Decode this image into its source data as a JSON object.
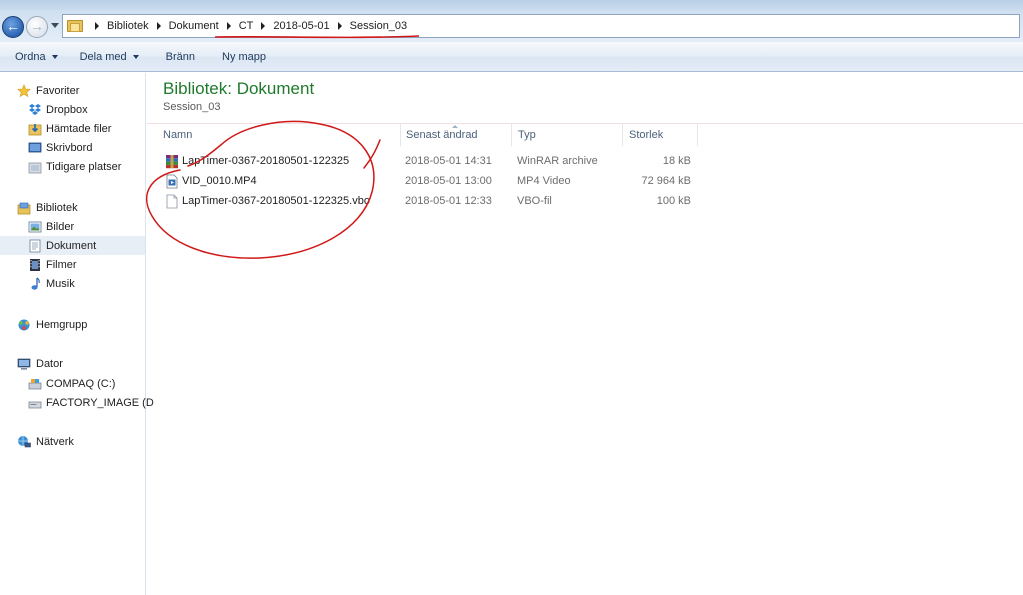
{
  "address": {
    "crumbs": [
      "Bibliotek",
      "Dokument",
      "CT",
      "2018-05-01",
      "Session_03"
    ]
  },
  "toolbar": {
    "organize_label": "Ordna",
    "share_label": "Dela med",
    "burn_label": "Bränn",
    "new_folder_label": "Ny mapp"
  },
  "sidebar": {
    "favorites_label": "Favoriter",
    "favorites": [
      "Dropbox",
      "Hämtade filer",
      "Skrivbord",
      "Tidigare platser"
    ],
    "libraries_label": "Bibliotek",
    "libraries": [
      "Bilder",
      "Dokument",
      "Filmer",
      "Musik"
    ],
    "selected": "Dokument",
    "homegroup_label": "Hemgrupp",
    "computer_label": "Dator",
    "drives": [
      "COMPAQ (C:)",
      "FACTORY_IMAGE (D"
    ],
    "network_label": "Nätverk"
  },
  "content": {
    "title": "Bibliotek: Dokument",
    "subtitle": "Session_03",
    "columns": {
      "name": "Namn",
      "modified": "Senast ändrad",
      "type": "Typ",
      "size": "Storlek"
    },
    "files": [
      {
        "name": "LapTimer-0367-20180501-122325",
        "modified": "2018-05-01 14:31",
        "type": "WinRAR archive",
        "size": "18 kB",
        "icon": "winrar-archive-icon"
      },
      {
        "name": "VID_0010.MP4",
        "modified": "2018-05-01 13:00",
        "type": "MP4 Video",
        "size": "72 964 kB",
        "icon": "video-file-icon"
      },
      {
        "name": "LapTimer-0367-20180501-122325.vbo",
        "modified": "2018-05-01 12:33",
        "type": "VBO-fil",
        "size": "100 kB",
        "icon": "blank-file-icon"
      }
    ]
  },
  "annotations": {
    "marker_color": "#d01818"
  },
  "colors": {
    "title_green": "#1f7a2c",
    "selection": "#e8eef6",
    "address_border": "#8ea4bf"
  }
}
